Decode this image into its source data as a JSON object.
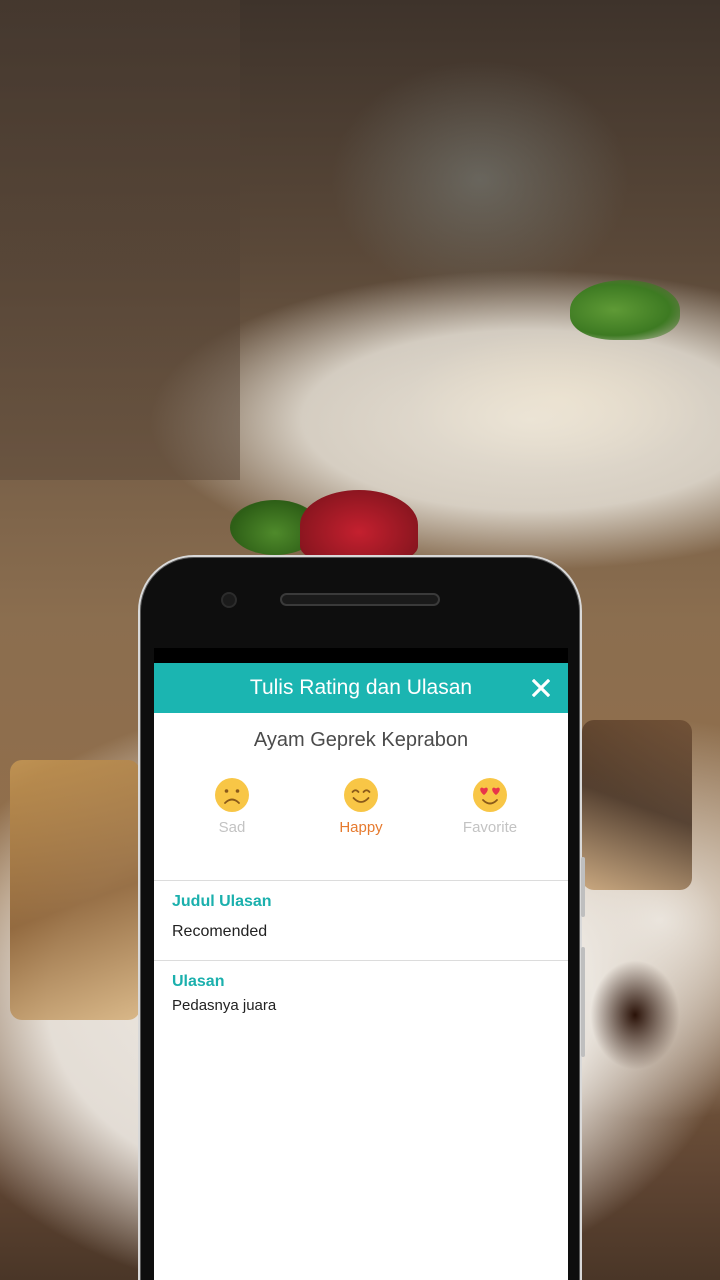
{
  "header": {
    "title": "Tulis Rating dan Ulasan",
    "close_icon": "close-icon"
  },
  "product": {
    "name": "Ayam Geprek Keprabon"
  },
  "ratings": [
    {
      "key": "sad",
      "label": "Sad",
      "icon": "sad-face-icon",
      "selected": false
    },
    {
      "key": "happy",
      "label": "Happy",
      "icon": "happy-face-icon",
      "selected": true
    },
    {
      "key": "favorite",
      "label": "Favorite",
      "icon": "heart-eyes-face-icon",
      "selected": false
    }
  ],
  "review_title": {
    "label": "Judul Ulasan",
    "value": "Recomended"
  },
  "review_body": {
    "label": "Ulasan",
    "value": "Pedasnya juara"
  },
  "colors": {
    "header": "#1bb5b1",
    "field_label": "#1bb0ad",
    "selected_label": "#e67a2e",
    "unselected_label": "#c3c3c3",
    "emoji_fill": "#f8c646"
  }
}
